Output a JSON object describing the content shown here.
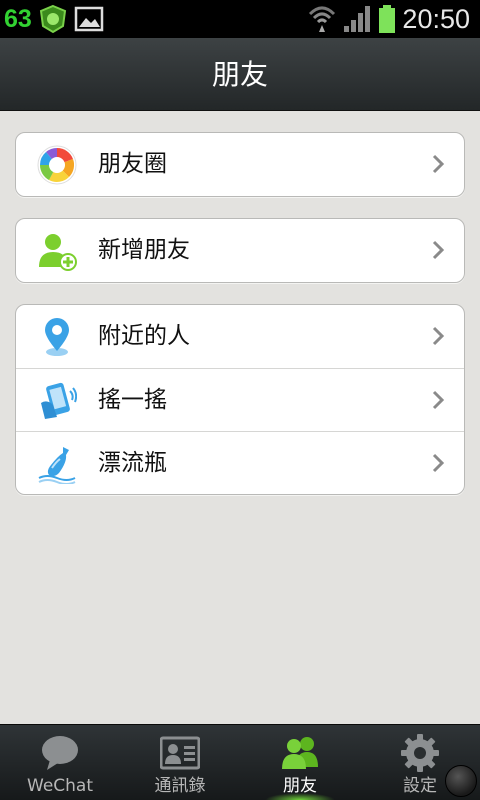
{
  "status_bar": {
    "notification_count": "63",
    "notification_icons": [
      "app-badge-icon",
      "image-icon"
    ],
    "system_icons": [
      "wifi-icon",
      "signal-icon",
      "battery-icon"
    ],
    "time": "20:50"
  },
  "header": {
    "title": "朋友"
  },
  "groups": [
    {
      "items": [
        {
          "label": "朋友圈",
          "icon": "moments-icon"
        }
      ]
    },
    {
      "items": [
        {
          "label": "新增朋友",
          "icon": "add-friend-icon"
        }
      ]
    },
    {
      "items": [
        {
          "label": "附近的人",
          "icon": "location-pin-icon"
        },
        {
          "label": "搖一搖",
          "icon": "shake-phone-icon"
        },
        {
          "label": "漂流瓶",
          "icon": "drift-bottle-icon"
        }
      ]
    }
  ],
  "tabs": [
    {
      "label": "WeChat",
      "icon": "chat-bubble-icon",
      "active": false
    },
    {
      "label": "通訊錄",
      "icon": "contacts-card-icon",
      "active": false
    },
    {
      "label": "朋友",
      "icon": "friends-icon",
      "active": true
    },
    {
      "label": "設定",
      "icon": "gear-icon",
      "active": false
    }
  ],
  "colors": {
    "accent_green": "#6fd23a",
    "background": "#e3e2df",
    "title_bar": "#2c3133"
  }
}
